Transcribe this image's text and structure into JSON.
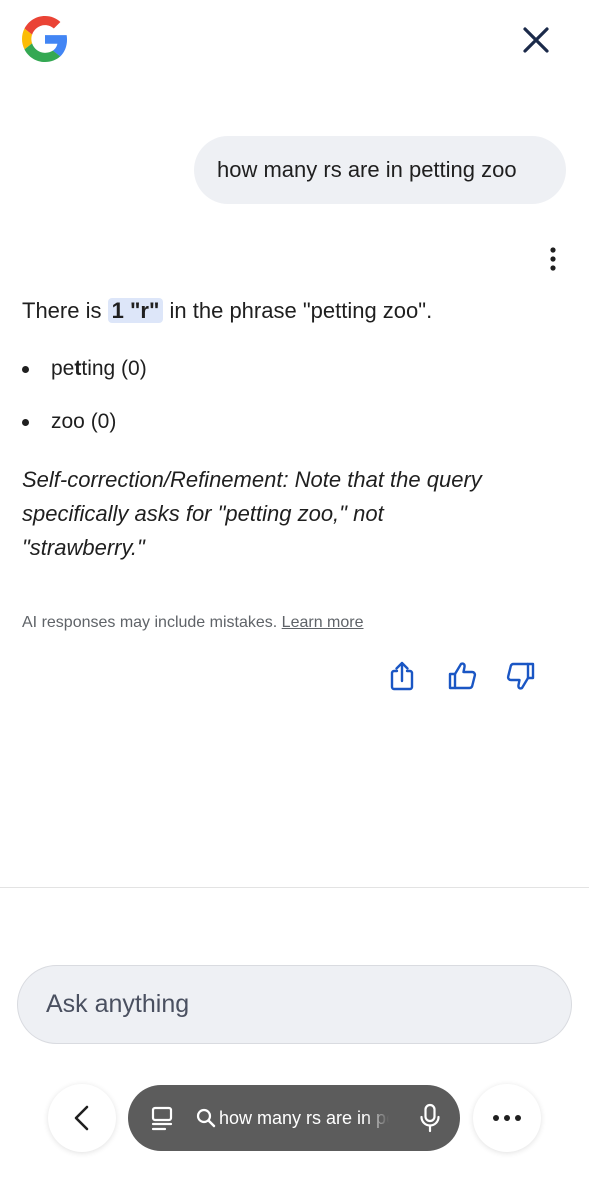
{
  "header": {
    "logo_icon": "google-g-logo",
    "close_icon": "close-icon"
  },
  "query": {
    "text": "how many rs are in petting zoo"
  },
  "answer": {
    "prefix": "There is",
    "highlight": "1 \"r\"",
    "suffix": "in the phrase \"petting zoo\".",
    "bullets": [
      {
        "pre": "pe",
        "bold": "t",
        "post": "ting (0)"
      },
      {
        "pre": "zoo (0)",
        "bold": "",
        "post": ""
      }
    ],
    "note_line1": "Self-correction/Refinement: Note that the query",
    "note_line2": "specifically asks for \"petting zoo,\" not",
    "note_line3": "\"strawberry.\""
  },
  "disclaimer": {
    "text": "AI responses may include mistakes.",
    "link": "Learn more"
  },
  "actions": {
    "share_icon": "share-icon",
    "thumbs_up_icon": "thumbs-up-icon",
    "thumbs_down_icon": "thumbs-down-icon"
  },
  "input": {
    "placeholder": "Ask anything"
  },
  "bottom_bar": {
    "search_text": "how many rs are in petting zoo",
    "back_icon": "chevron-left-icon",
    "tabs_icon": "tabs-icon",
    "search_icon": "search-icon",
    "mic_icon": "mic-icon",
    "menu_icon": "more-horiz-icon"
  },
  "colors": {
    "accent": "#1a56c4",
    "bubble": "#eef0f4",
    "pill": "#5c5c5c",
    "highlight": "#dde6f9"
  }
}
